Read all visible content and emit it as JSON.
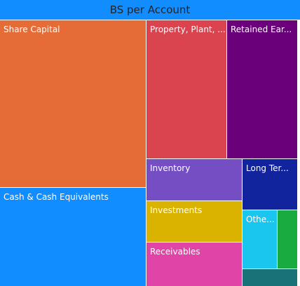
{
  "header": {
    "title": "BS per Account"
  },
  "chart_data": {
    "type": "treemap",
    "title": "BS per Account",
    "tiles": [
      {
        "label": "Share Capital",
        "color": "#E66C37"
      },
      {
        "label": "Cash & Cash Equivalents",
        "color": "#118DFF"
      },
      {
        "label": "Property, Plant, ...",
        "color": "#D9444F"
      },
      {
        "label": "Retained Ear...",
        "color": "#6B007B"
      },
      {
        "label": "Inventory",
        "color": "#744EC2"
      },
      {
        "label": "Investments",
        "color": "#D9B300"
      },
      {
        "label": "Receivables",
        "color": "#E044A7"
      },
      {
        "label": "Long Ter...",
        "color": "#12239E"
      },
      {
        "label": "Othe...",
        "color": "#1AC6EE"
      },
      {
        "label": "",
        "color": "#1AAB40"
      },
      {
        "label": "",
        "color": "#197278"
      }
    ]
  }
}
